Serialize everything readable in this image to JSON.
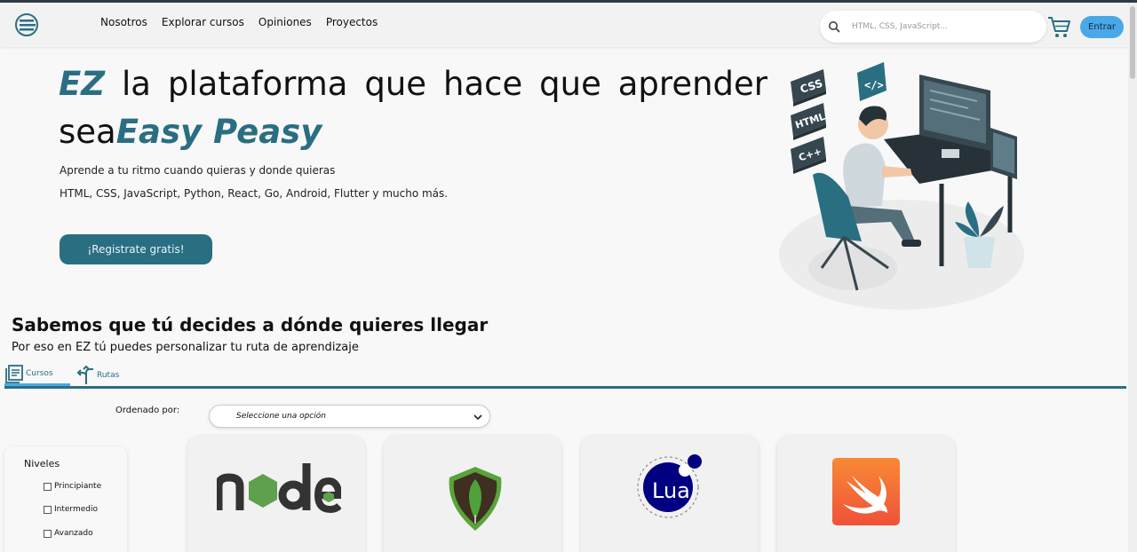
{
  "header": {
    "nav": [
      "Nosotros",
      "Explorar cursos",
      "Opiniones",
      "Proyectos"
    ],
    "search_placeholder": "HTML, CSS, JavaScript...",
    "login_label": "Entrar"
  },
  "hero": {
    "title_brand": "EZ",
    "title_rest": " la plataforma que hace que aprender",
    "title_line2_prefix": "sea",
    "title_line2_brand": "Easy Peasy",
    "subtitle1": "Aprende a tu ritmo cuando quieras y donde quieras",
    "subtitle2": "HTML, CSS, JavaScript, Python, React, Go, Android, Flutter y mucho más.",
    "cta_label": "¡Registrate gratis!",
    "illustration_tags": [
      "CSS",
      "HTML",
      "C++",
      "</>"
    ]
  },
  "section": {
    "title": "Sabemos que tú decides a dónde quieres llegar",
    "subtitle": "Por eso en EZ tú puedes personalizar tu ruta de aprendizaje",
    "tabs": [
      {
        "label": "Cursos",
        "icon": "book-icon",
        "active": true
      },
      {
        "label": "Rutas",
        "icon": "route-arrow-icon",
        "active": false
      }
    ]
  },
  "sort": {
    "label": "Ordenado por:",
    "selected": "Seleccione una opción"
  },
  "filters": {
    "title": "Niveles",
    "options": [
      "Principiante",
      "Intermedio",
      "Avanzado"
    ]
  },
  "courses": [
    {
      "logo": "nodejs-logo"
    },
    {
      "logo": "mongodb-logo"
    },
    {
      "logo": "lua-logo",
      "logo_text": "Lua"
    },
    {
      "logo": "swift-logo"
    }
  ],
  "colors": {
    "brand": "#2a6e82",
    "accent": "#4aa8e8",
    "node_green": "#5fa04e",
    "mongo_green": "#4fa13a",
    "lua_blue": "#000080",
    "swift_orange": "#f05138"
  }
}
